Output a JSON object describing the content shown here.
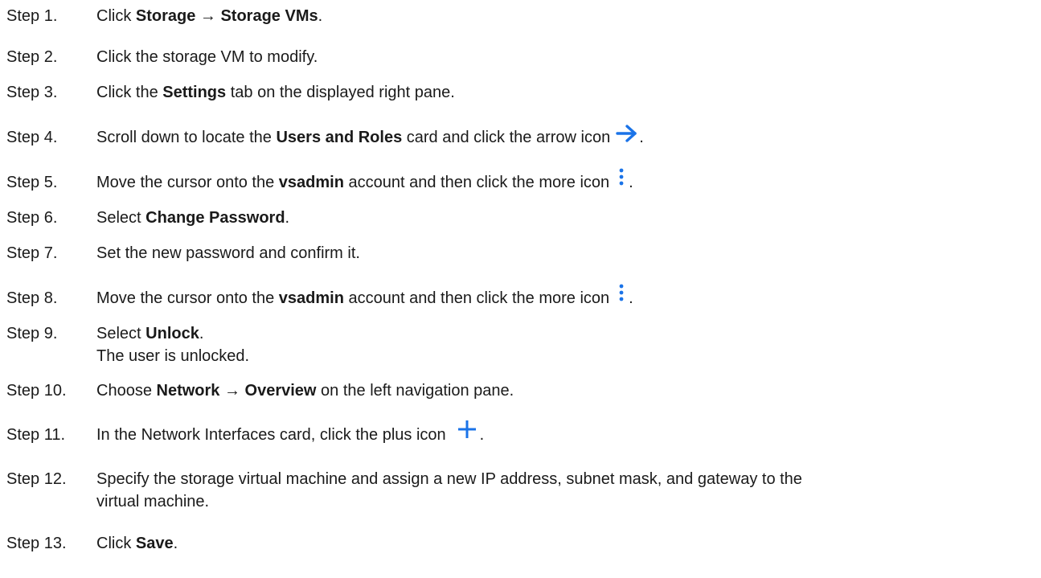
{
  "steps": [
    {
      "label": "Step 1.",
      "parts": {
        "a": "Click ",
        "b": "Storage → Storage VMs",
        "c": "."
      }
    },
    {
      "label": "Step 2.",
      "parts": {
        "a": "Click the storage VM to modify."
      }
    },
    {
      "label": "Step 3.",
      "parts": {
        "a": "Click the ",
        "b": "Settings",
        "c": " tab on the displayed right pane."
      }
    },
    {
      "label": "Step 4.",
      "parts": {
        "a": "Scroll down to locate the ",
        "b": "Users and Roles",
        "c": " card and click the arrow icon",
        "d": "."
      }
    },
    {
      "label": "Step 5.",
      "parts": {
        "a": "Move the cursor onto the ",
        "b": "vsadmin",
        "c": " account and then click the more icon",
        "d": "."
      }
    },
    {
      "label": "Step 6.",
      "parts": {
        "a": "Select ",
        "b": "Change Password",
        "c": "."
      }
    },
    {
      "label": "Step 7.",
      "parts": {
        "a": "Set the new password and confirm it."
      }
    },
    {
      "label": "Step 8.",
      "parts": {
        "a": "Move the cursor onto the ",
        "b": "vsadmin",
        "c": " account and then click the more icon",
        "d": "."
      }
    },
    {
      "label": "Step 9.",
      "parts": {
        "a": "Select ",
        "b": "Unlock",
        "c": ".",
        "line2": "The user is unlocked."
      }
    },
    {
      "label": "Step 10.",
      "parts": {
        "a": "Choose ",
        "b": "Network → Overview",
        "c": " on the left navigation pane."
      }
    },
    {
      "label": "Step 11.",
      "parts": {
        "a": "In the Network Interfaces card, click the plus icon",
        "d": "."
      }
    },
    {
      "label": "Step 12.",
      "parts": {
        "a": "Specify the storage virtual machine and assign a new IP address, subnet mask, and gateway to the",
        "line2": "virtual machine."
      }
    },
    {
      "label": "Step 13.",
      "parts": {
        "a": "Click ",
        "b": "Save",
        "c": "."
      }
    }
  ],
  "icons": {
    "arrow": "arrow-right-icon",
    "more": "more-vertical-icon",
    "plus": "plus-icon",
    "accent_color": "#1a73e8"
  }
}
